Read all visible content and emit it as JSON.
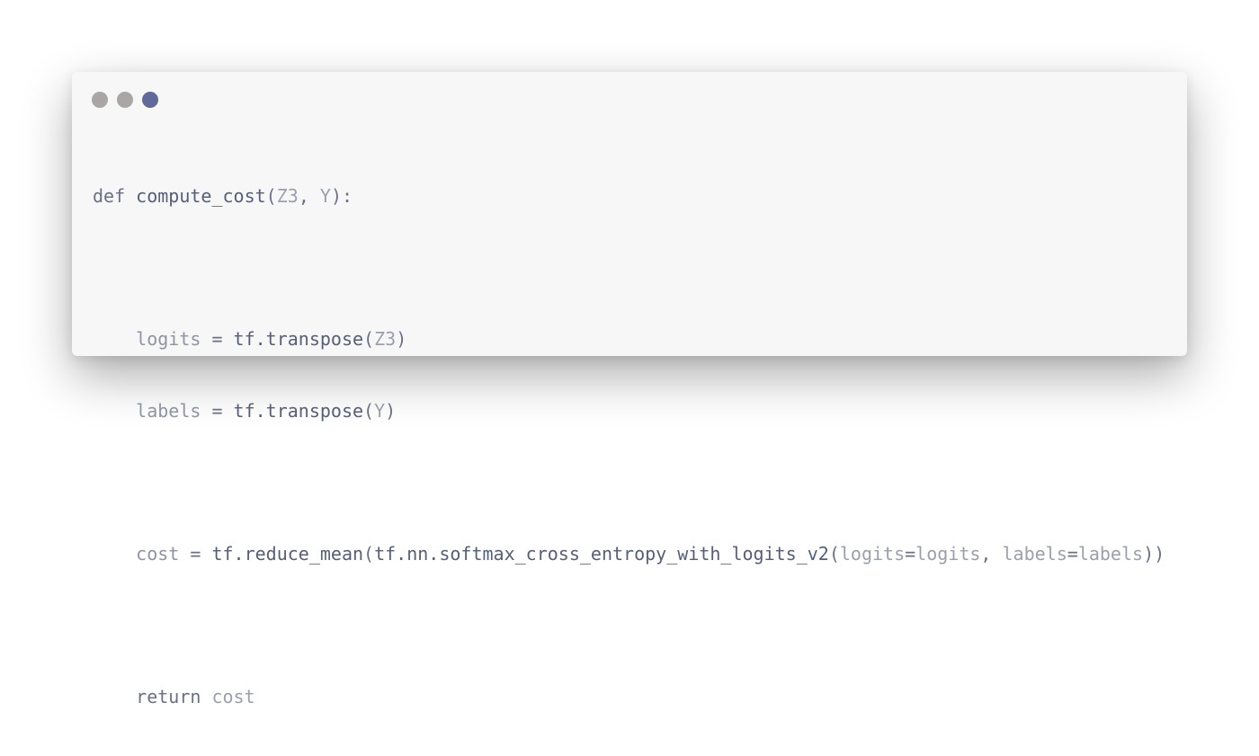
{
  "window": {
    "controls": [
      {
        "name": "close",
        "color": "#aaa6a6"
      },
      {
        "name": "minimize",
        "color": "#aaa6a6"
      },
      {
        "name": "maximize",
        "color": "#5f6a9b"
      }
    ]
  },
  "code": {
    "line1": {
      "kw": "def",
      "fn": "compute_cost",
      "p1": "Z3",
      "sep": ", ",
      "p2": "Y",
      "end": "):"
    },
    "line3": {
      "lhs": "logits",
      "eq": " = ",
      "fn": "tf.transpose",
      "open": "(",
      "arg": "Z3",
      "close": ")"
    },
    "line4": {
      "lhs": "labels",
      "eq": " = ",
      "fn": "tf.transpose",
      "open": "(",
      "arg": "Y",
      "close": ")"
    },
    "line6": {
      "lhs": "cost",
      "eq": " = ",
      "fn1": "tf.reduce_mean",
      "open1": "(",
      "fn2": "tf.nn.softmax_cross_entropy_with_logits_v2",
      "open2": "(",
      "k1": "logits",
      "e1": "=",
      "v1": "logits",
      "sep": ", ",
      "k2": "labels",
      "e2": "=",
      "v2": "labels",
      "close": "))"
    },
    "line8": {
      "kw": "return",
      "val": "cost"
    }
  }
}
